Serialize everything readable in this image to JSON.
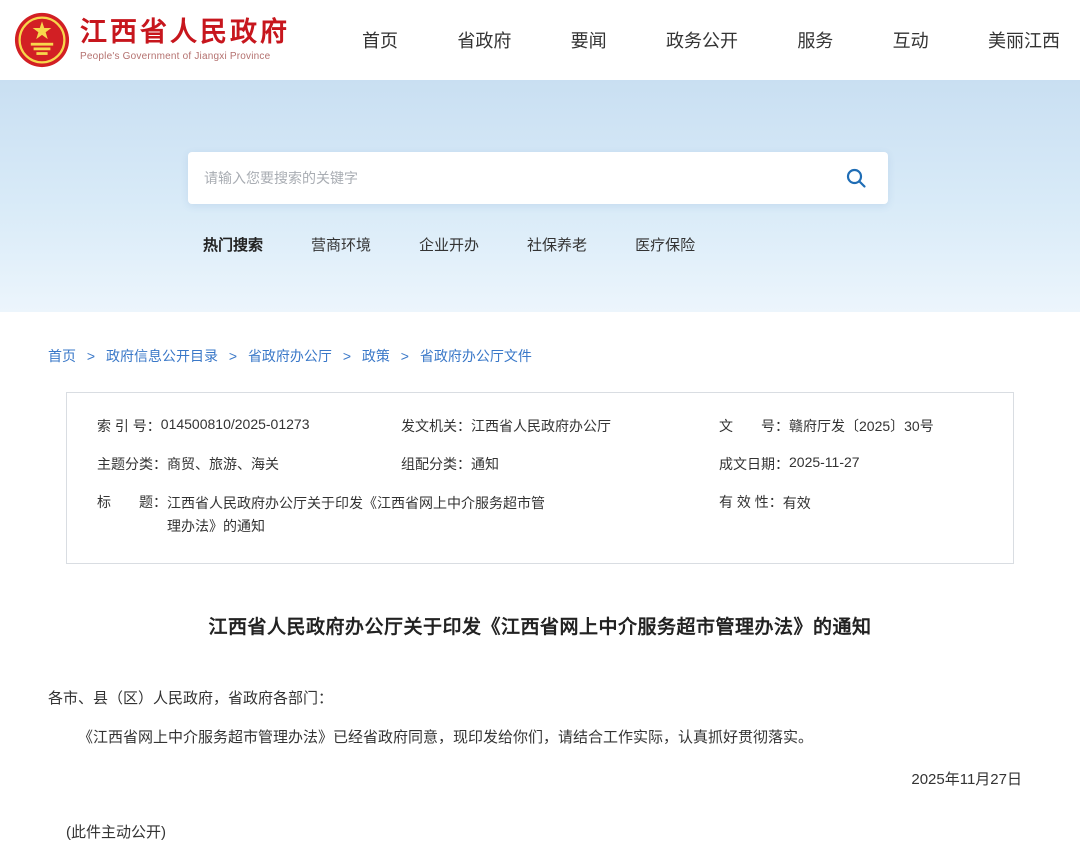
{
  "header": {
    "site_title": "江西省人民政府",
    "site_subtitle": "People's Government of Jiangxi Province",
    "nav": [
      "首页",
      "省政府",
      "要闻",
      "政务公开",
      "服务",
      "互动",
      "美丽江西"
    ]
  },
  "search": {
    "placeholder": "请输入您要搜索的关键字",
    "hot_label": "热门搜索",
    "hot_links": [
      "营商环境",
      "企业开办",
      "社保养老",
      "医疗保险"
    ]
  },
  "breadcrumb": {
    "separator": ">",
    "items": [
      "首页",
      "政府信息公开目录",
      "省政府办公厅",
      "政策",
      "省政府办公厅文件"
    ]
  },
  "meta": {
    "index_label": "索 引 号：",
    "index_value": "014500810/2025-01273",
    "issuer_label": "发文机关：",
    "issuer_value": "江西省人民政府办公厅",
    "doc_label": "文　　号：",
    "doc_value": "赣府厅发〔2025〕30号",
    "topic_label": "主题分类：",
    "topic_value": "商贸、旅游、海关",
    "group_label": "组配分类：",
    "group_value": "通知",
    "date_label": "成文日期：",
    "date_value": "2025-11-27",
    "title_label": "标　　题：",
    "title_value": "江西省人民政府办公厅关于印发《江西省网上中介服务超市管理办法》的通知",
    "valid_label": "有 效 性：",
    "valid_value": "有效"
  },
  "article": {
    "title": "江西省人民政府办公厅关于印发《江西省网上中介服务超市管理办法》的通知",
    "salutation": "各市、县（区）人民政府，省政府各部门：",
    "paragraph": "《江西省网上中介服务超市管理办法》已经省政府同意，现印发给你们，请结合工作实际，认真抓好贯彻落实。",
    "date": "2025年11月27日",
    "note": "(此件主动公开)"
  },
  "colors": {
    "brand_red": "#c7161d",
    "link_blue": "#3a78c8",
    "banner_blue": "#c9dff2"
  }
}
